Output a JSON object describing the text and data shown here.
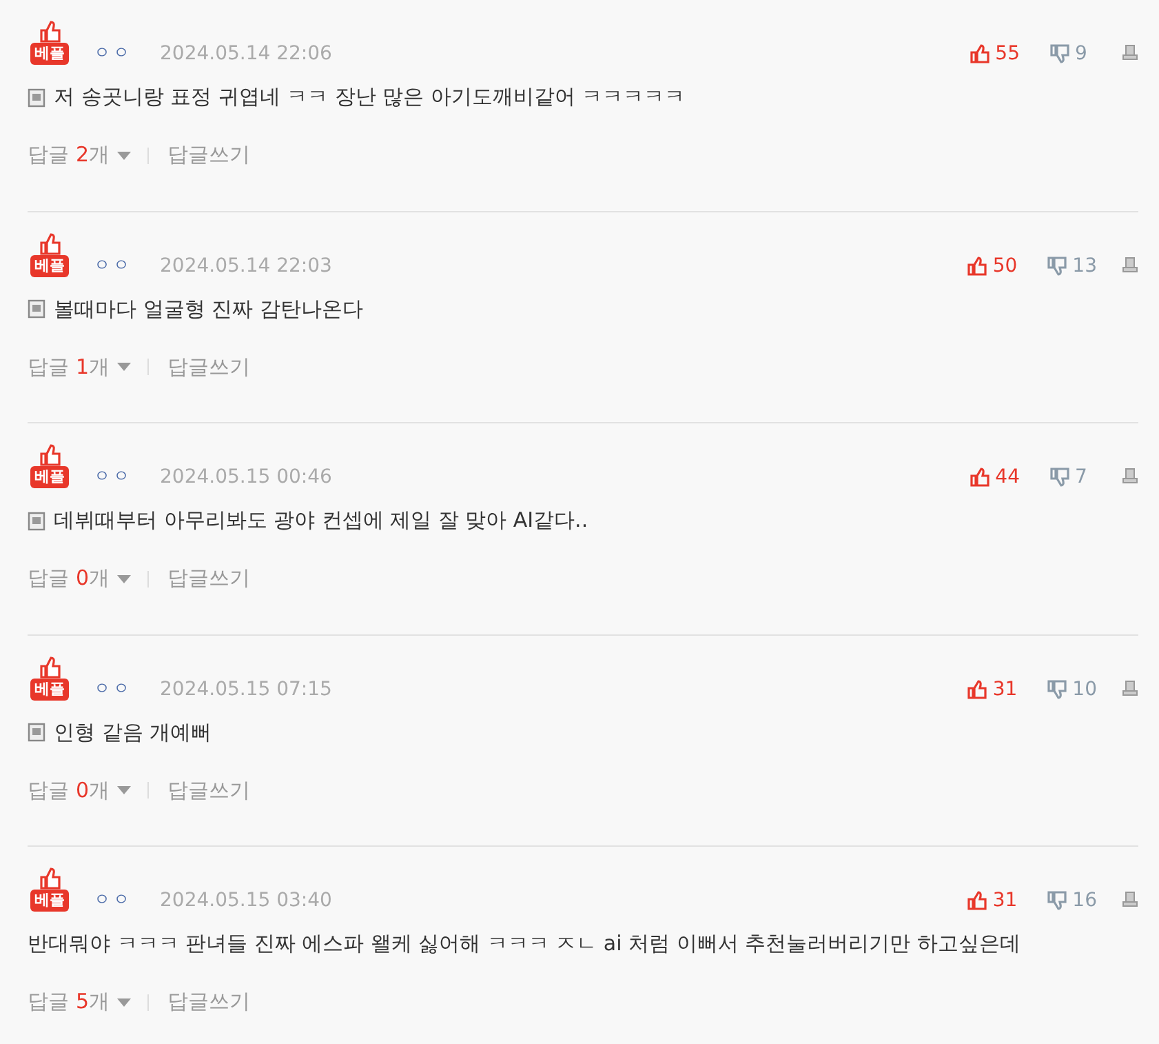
{
  "comments": [
    {
      "badge": "베플",
      "nickname": "ㅇㅇ",
      "date": "2024.05.14 22:06",
      "likes": "55",
      "dislikes": "9",
      "has_doc_icon": true,
      "text": "저 송곳니랑 표정 귀엽네 ㅋㅋ 장난 많은 아기도깨비같어 ㅋㅋㅋㅋㅋ",
      "reply_label": "답글",
      "reply_count": "2",
      "reply_unit": "개",
      "write_reply": "답글쓰기"
    },
    {
      "badge": "베플",
      "nickname": "ㅇㅇ",
      "date": "2024.05.14 22:03",
      "likes": "50",
      "dislikes": "13",
      "has_doc_icon": true,
      "text": "볼때마다 얼굴형 진짜 감탄나온다",
      "reply_label": "답글",
      "reply_count": "1",
      "reply_unit": "개",
      "write_reply": "답글쓰기"
    },
    {
      "badge": "베플",
      "nickname": "ㅇㅇ",
      "date": "2024.05.15 00:46",
      "likes": "44",
      "dislikes": "7",
      "has_doc_icon": true,
      "text": "데뷔때부터 아무리봐도 광야 컨셉에 제일 잘 맞아 AI같다..",
      "reply_label": "답글",
      "reply_count": "0",
      "reply_unit": "개",
      "write_reply": "답글쓰기"
    },
    {
      "badge": "베플",
      "nickname": "ㅇㅇ",
      "date": "2024.05.15 07:15",
      "likes": "31",
      "dislikes": "10",
      "has_doc_icon": true,
      "text": "인형 같음 개예뻐",
      "reply_label": "답글",
      "reply_count": "0",
      "reply_unit": "개",
      "write_reply": "답글쓰기"
    },
    {
      "badge": "베플",
      "nickname": "ㅇㅇ",
      "date": "2024.05.15 03:40",
      "likes": "31",
      "dislikes": "16",
      "has_doc_icon": false,
      "text": "반대뭐야 ㅋㅋㅋ 판녀들 진짜 에스파 왤케 싫어해 ㅋㅋㅋ ㅈㄴ ai 처럼 이뻐서 추천눌러버리기만 하고싶은데",
      "reply_label": "답글",
      "reply_count": "5",
      "reply_unit": "개",
      "write_reply": "답글쓰기"
    }
  ]
}
